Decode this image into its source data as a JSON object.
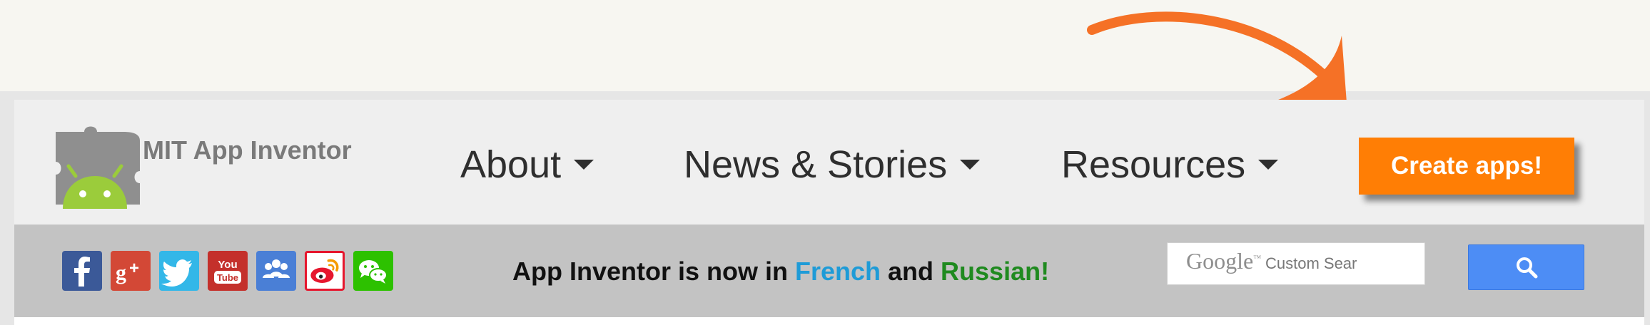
{
  "brand": {
    "logo_text": "MIT App Inventor"
  },
  "nav": {
    "items": [
      {
        "label": "About"
      },
      {
        "label": "News & Stories"
      },
      {
        "label": "Resources"
      }
    ],
    "cta_label": "Create apps!"
  },
  "social": [
    {
      "name": "facebook-icon",
      "color": "#3b5998"
    },
    {
      "name": "google-plus-icon",
      "color": "#d34836"
    },
    {
      "name": "twitter-icon",
      "color": "#33b7e8"
    },
    {
      "name": "youtube-icon",
      "color": "#c4302b"
    },
    {
      "name": "google-groups-icon",
      "color": "#4a7fd6"
    },
    {
      "name": "weibo-icon",
      "color": "#e6162d"
    },
    {
      "name": "wechat-icon",
      "color": "#2dc100"
    }
  ],
  "announcement": {
    "prefix": "App Inventor is now in ",
    "french": "French",
    "middle": " and ",
    "russian": "Russian!"
  },
  "search": {
    "google_word": "Google",
    "tm": "™",
    "placeholder": "Custom Sear",
    "button_icon": "search-icon"
  },
  "colors": {
    "accent": "#ff7e05",
    "arrow": "#f57126",
    "search_button": "#4d8df5"
  }
}
